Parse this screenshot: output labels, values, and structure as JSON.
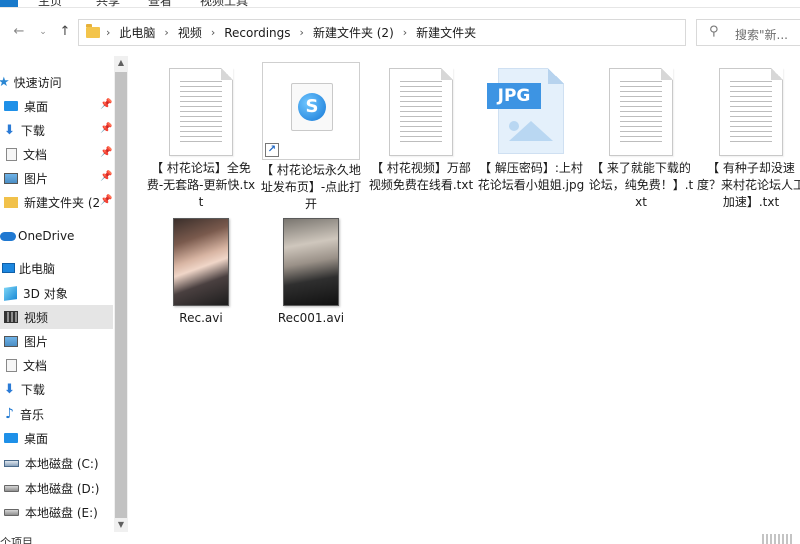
{
  "ribbon": {
    "tabs": [
      "主页",
      "共享",
      "查看",
      "视频工具"
    ]
  },
  "nav": {
    "crumbs": [
      "此电脑",
      "视频",
      "Recordings",
      "新建文件夹 (2)",
      "新建文件夹"
    ],
    "search_placeholder": "搜索\"新..."
  },
  "sidebar": {
    "quick_access": "快速访问",
    "items": [
      {
        "label": "桌面",
        "icon": "desktop-icon",
        "pinned": true
      },
      {
        "label": "下载",
        "icon": "download-icon",
        "pinned": true
      },
      {
        "label": "文档",
        "icon": "document-icon",
        "pinned": true
      },
      {
        "label": "图片",
        "icon": "picture-icon",
        "pinned": true
      },
      {
        "label": "新建文件夹 (2",
        "icon": "folder-icon",
        "pinned": true
      }
    ],
    "onedrive": "OneDrive",
    "this_pc": "此电脑",
    "pc_items": [
      {
        "label": "3D 对象",
        "icon": "3d-objects-icon"
      },
      {
        "label": "视频",
        "icon": "video-icon",
        "selected": true
      },
      {
        "label": "图片",
        "icon": "picture-icon"
      },
      {
        "label": "文档",
        "icon": "document-icon"
      },
      {
        "label": "下载",
        "icon": "download-icon"
      },
      {
        "label": "音乐",
        "icon": "music-icon"
      },
      {
        "label": "桌面",
        "icon": "desktop-icon"
      },
      {
        "label": "本地磁盘 (C:)",
        "icon": "system-drive-icon"
      },
      {
        "label": "本地磁盘 (D:)",
        "icon": "drive-icon"
      },
      {
        "label": "本地磁盘 (E:)",
        "icon": "drive-icon"
      }
    ]
  },
  "files": [
    {
      "name": "【 村花论坛】全免费-无套路-更新快.txt",
      "type": "txt"
    },
    {
      "name": "【 村花论坛永久地址发布页】-点此打开",
      "type": "url"
    },
    {
      "name": "【 村花视频】万部视频免费在线看.txt",
      "type": "txt"
    },
    {
      "name": "【 解压密码】:上村花论坛看小姐姐.jpg",
      "type": "jpg",
      "badge": "JPG"
    },
    {
      "name": "【 来了就能下载的论坛，纯免费！】.txt",
      "type": "txt"
    },
    {
      "name": "【 有种子却没速度？来村花论坛人工加速】.txt",
      "type": "txt"
    },
    {
      "name": "Rec.avi",
      "type": "avi"
    },
    {
      "name": "Rec001.avi",
      "type": "avi"
    }
  ],
  "status": {
    "text": "个项目"
  }
}
